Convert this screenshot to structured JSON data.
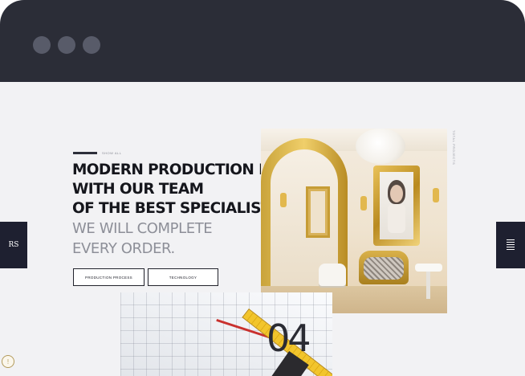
{
  "hero": {
    "eyebrow": "SHOW ALL",
    "headline_lines": [
      "MODERN PRODUCTION PLANT",
      "WITH OUR TEAM",
      "OF THE BEST SPECIALISTS"
    ],
    "subline_lines": [
      "WE WILL COMPLETE",
      "EVERY ORDER."
    ],
    "buttons": [
      "PRODUCTION PROCESS",
      "TECHNOLOGY"
    ]
  },
  "slider": {
    "counter": "04",
    "side_text": "TOTAL PROJECTS"
  },
  "side_nav": {
    "logo": "RS"
  },
  "info_badge": "!",
  "colors": {
    "titlebar": "#2b2d37",
    "window_dot": "#585b69",
    "dark_nav": "#1e2030",
    "headline": "#15161c",
    "subline": "#8d8f98"
  },
  "icons": {
    "menu": "hamburger-icon",
    "info": "info-icon"
  }
}
